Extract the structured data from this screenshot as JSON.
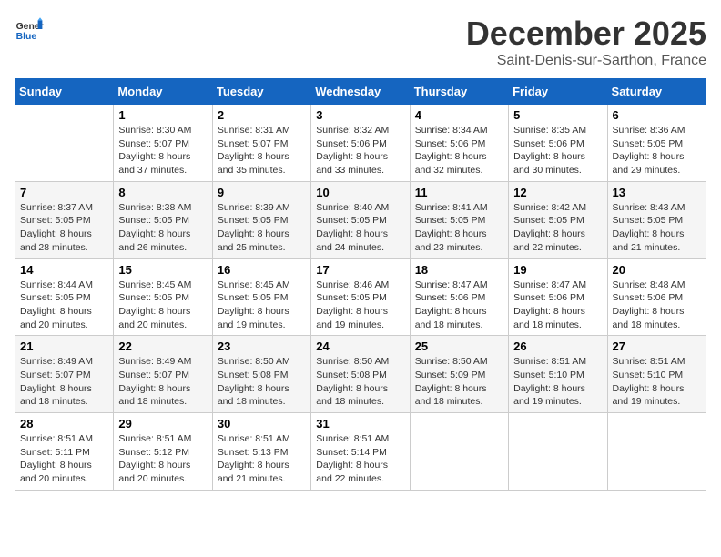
{
  "header": {
    "logo_general": "General",
    "logo_blue": "Blue",
    "title": "December 2025",
    "subtitle": "Saint-Denis-sur-Sarthon, France"
  },
  "days_of_week": [
    "Sunday",
    "Monday",
    "Tuesday",
    "Wednesday",
    "Thursday",
    "Friday",
    "Saturday"
  ],
  "weeks": [
    [
      {
        "day": "",
        "info": ""
      },
      {
        "day": "1",
        "info": "Sunrise: 8:30 AM\nSunset: 5:07 PM\nDaylight: 8 hours\nand 37 minutes."
      },
      {
        "day": "2",
        "info": "Sunrise: 8:31 AM\nSunset: 5:07 PM\nDaylight: 8 hours\nand 35 minutes."
      },
      {
        "day": "3",
        "info": "Sunrise: 8:32 AM\nSunset: 5:06 PM\nDaylight: 8 hours\nand 33 minutes."
      },
      {
        "day": "4",
        "info": "Sunrise: 8:34 AM\nSunset: 5:06 PM\nDaylight: 8 hours\nand 32 minutes."
      },
      {
        "day": "5",
        "info": "Sunrise: 8:35 AM\nSunset: 5:06 PM\nDaylight: 8 hours\nand 30 minutes."
      },
      {
        "day": "6",
        "info": "Sunrise: 8:36 AM\nSunset: 5:05 PM\nDaylight: 8 hours\nand 29 minutes."
      }
    ],
    [
      {
        "day": "7",
        "info": "Sunrise: 8:37 AM\nSunset: 5:05 PM\nDaylight: 8 hours\nand 28 minutes."
      },
      {
        "day": "8",
        "info": "Sunrise: 8:38 AM\nSunset: 5:05 PM\nDaylight: 8 hours\nand 26 minutes."
      },
      {
        "day": "9",
        "info": "Sunrise: 8:39 AM\nSunset: 5:05 PM\nDaylight: 8 hours\nand 25 minutes."
      },
      {
        "day": "10",
        "info": "Sunrise: 8:40 AM\nSunset: 5:05 PM\nDaylight: 8 hours\nand 24 minutes."
      },
      {
        "day": "11",
        "info": "Sunrise: 8:41 AM\nSunset: 5:05 PM\nDaylight: 8 hours\nand 23 minutes."
      },
      {
        "day": "12",
        "info": "Sunrise: 8:42 AM\nSunset: 5:05 PM\nDaylight: 8 hours\nand 22 minutes."
      },
      {
        "day": "13",
        "info": "Sunrise: 8:43 AM\nSunset: 5:05 PM\nDaylight: 8 hours\nand 21 minutes."
      }
    ],
    [
      {
        "day": "14",
        "info": "Sunrise: 8:44 AM\nSunset: 5:05 PM\nDaylight: 8 hours\nand 20 minutes."
      },
      {
        "day": "15",
        "info": "Sunrise: 8:45 AM\nSunset: 5:05 PM\nDaylight: 8 hours\nand 20 minutes."
      },
      {
        "day": "16",
        "info": "Sunrise: 8:45 AM\nSunset: 5:05 PM\nDaylight: 8 hours\nand 19 minutes."
      },
      {
        "day": "17",
        "info": "Sunrise: 8:46 AM\nSunset: 5:05 PM\nDaylight: 8 hours\nand 19 minutes."
      },
      {
        "day": "18",
        "info": "Sunrise: 8:47 AM\nSunset: 5:06 PM\nDaylight: 8 hours\nand 18 minutes."
      },
      {
        "day": "19",
        "info": "Sunrise: 8:47 AM\nSunset: 5:06 PM\nDaylight: 8 hours\nand 18 minutes."
      },
      {
        "day": "20",
        "info": "Sunrise: 8:48 AM\nSunset: 5:06 PM\nDaylight: 8 hours\nand 18 minutes."
      }
    ],
    [
      {
        "day": "21",
        "info": "Sunrise: 8:49 AM\nSunset: 5:07 PM\nDaylight: 8 hours\nand 18 minutes."
      },
      {
        "day": "22",
        "info": "Sunrise: 8:49 AM\nSunset: 5:07 PM\nDaylight: 8 hours\nand 18 minutes."
      },
      {
        "day": "23",
        "info": "Sunrise: 8:50 AM\nSunset: 5:08 PM\nDaylight: 8 hours\nand 18 minutes."
      },
      {
        "day": "24",
        "info": "Sunrise: 8:50 AM\nSunset: 5:08 PM\nDaylight: 8 hours\nand 18 minutes."
      },
      {
        "day": "25",
        "info": "Sunrise: 8:50 AM\nSunset: 5:09 PM\nDaylight: 8 hours\nand 18 minutes."
      },
      {
        "day": "26",
        "info": "Sunrise: 8:51 AM\nSunset: 5:10 PM\nDaylight: 8 hours\nand 19 minutes."
      },
      {
        "day": "27",
        "info": "Sunrise: 8:51 AM\nSunset: 5:10 PM\nDaylight: 8 hours\nand 19 minutes."
      }
    ],
    [
      {
        "day": "28",
        "info": "Sunrise: 8:51 AM\nSunset: 5:11 PM\nDaylight: 8 hours\nand 20 minutes."
      },
      {
        "day": "29",
        "info": "Sunrise: 8:51 AM\nSunset: 5:12 PM\nDaylight: 8 hours\nand 20 minutes."
      },
      {
        "day": "30",
        "info": "Sunrise: 8:51 AM\nSunset: 5:13 PM\nDaylight: 8 hours\nand 21 minutes."
      },
      {
        "day": "31",
        "info": "Sunrise: 8:51 AM\nSunset: 5:14 PM\nDaylight: 8 hours\nand 22 minutes."
      },
      {
        "day": "",
        "info": ""
      },
      {
        "day": "",
        "info": ""
      },
      {
        "day": "",
        "info": ""
      }
    ]
  ]
}
